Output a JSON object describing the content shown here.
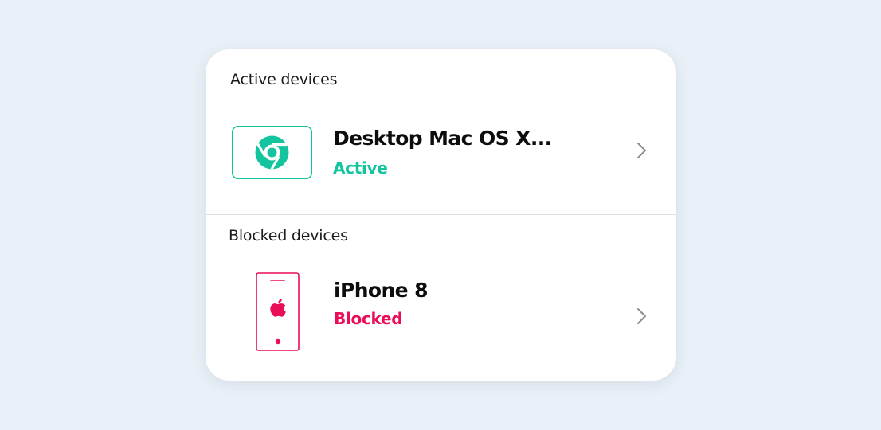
{
  "colors": {
    "active": "#14c49f",
    "blocked": "#ea0d57",
    "page_background": "#e9f0f7"
  },
  "active_section": {
    "title": "Active devices",
    "device": {
      "name": "Desktop Mac OS X...",
      "status": "Active",
      "icon": "chrome-icon"
    }
  },
  "blocked_section": {
    "title": "Blocked devices",
    "device": {
      "name": "iPhone 8",
      "status": "Blocked",
      "icon": "iphone-icon"
    }
  }
}
